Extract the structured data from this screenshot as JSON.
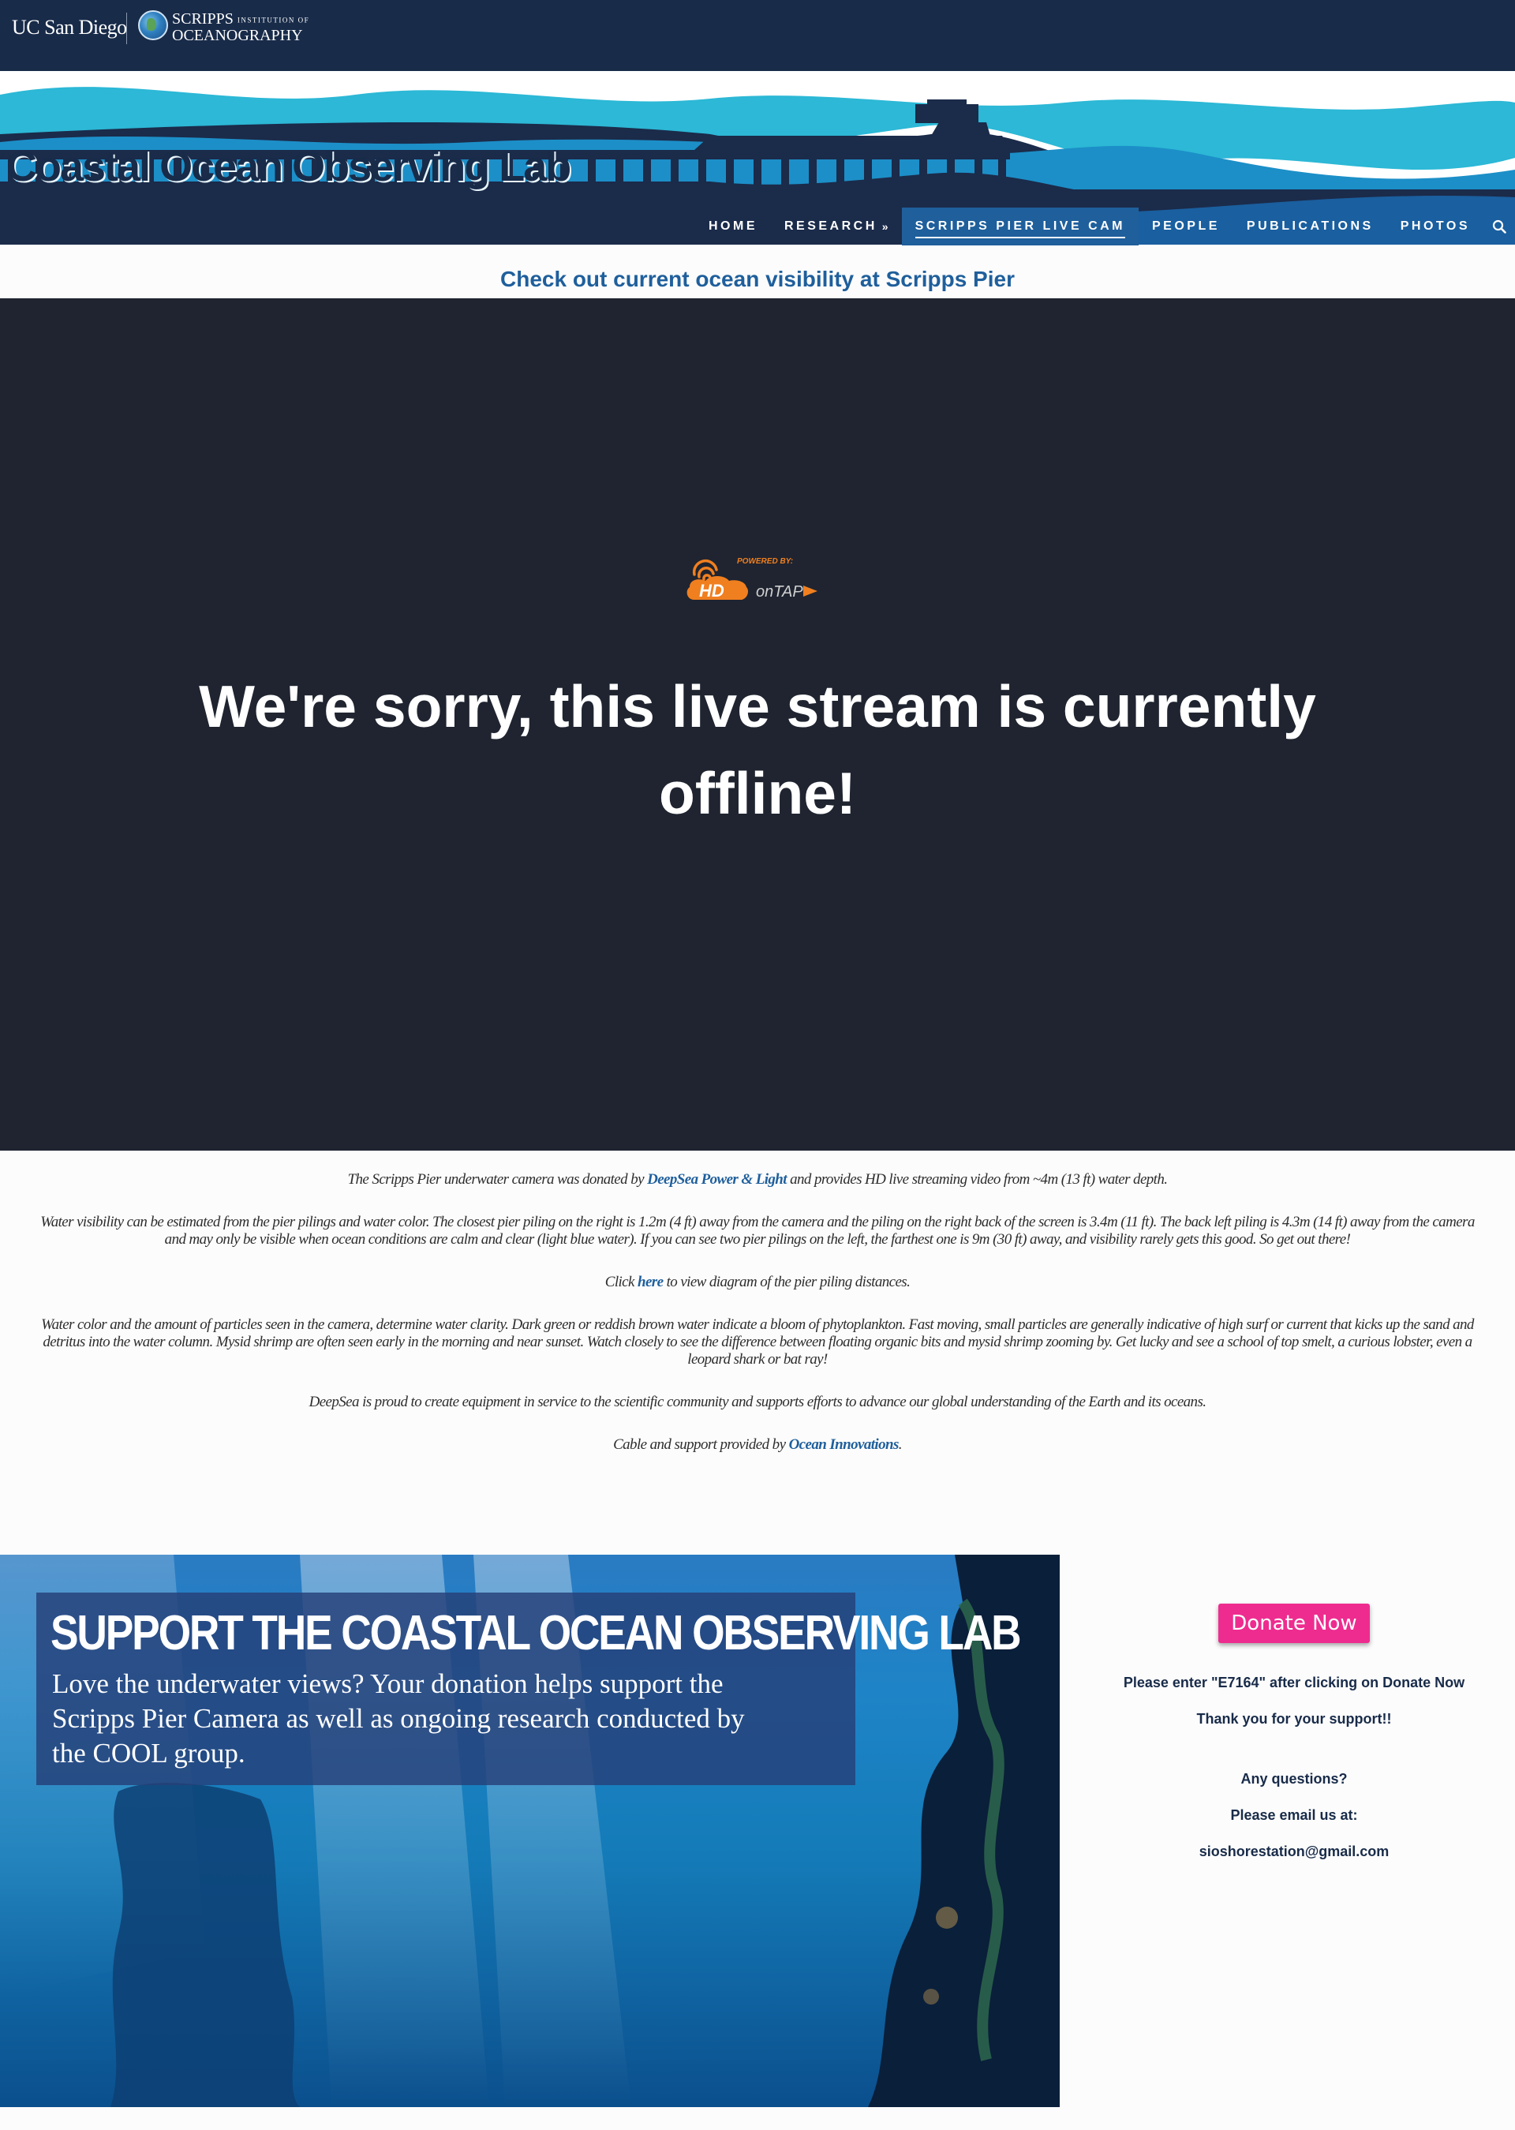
{
  "header": {
    "ucsd_logo": "UC San Diego",
    "scripps_logo_line1": "SCRIPPS",
    "scripps_logo_small": "INSTITUTION OF",
    "scripps_logo_line2": "OCEANOGRAPHY"
  },
  "banner": {
    "site_title": "Coastal Ocean Observing Lab"
  },
  "nav": {
    "items": [
      {
        "label": "HOME"
      },
      {
        "label": "RESEARCH"
      },
      {
        "label": "SCRIPPS PIER LIVE CAM"
      },
      {
        "label": "PEOPLE"
      },
      {
        "label": "PUBLICATIONS"
      },
      {
        "label": "PHOTOS"
      }
    ],
    "active": "SCRIPPS PIER LIVE CAM",
    "research_chevron_icon": "double-chevron-down-icon",
    "search_icon": "search-icon"
  },
  "headline": "Check out current ocean visibility at Scripps Pier",
  "video": {
    "logo_powered": "POWERED BY:",
    "logo_hd": "HD",
    "logo_ontap": "onTAP",
    "message": "We're sorry, this live stream is currently offline!"
  },
  "description": {
    "p1_pre": "The Scripps Pier underwater camera was donated by ",
    "p1_link": "DeepSea Power & Light",
    "p1_post": " and provides HD live streaming video from ~4m (13 ft) water depth.",
    "p2": "Water visibility can be estimated  from the pier pilings and water color. The closest  pier piling on the right is  1.2m (4 ft)  away from the camera and the piling on the right back of the screen is 3.4m (11 ft). The back left piling is 4.3m (14 ft) away from the camera and  may only be visible when ocean conditions are calm and clear (light blue water).  If you can  see two pier pilings on the left, the farthest one  is 9m (30 ft) away, and visibility rarely gets this good. So get out there!",
    "p3_pre": "Click ",
    "p3_link": "here",
    "p3_post": " to view diagram of the pier piling distances.",
    "p4": "Water color and the amount of particles seen in the camera, determine water clarity. Dark green or reddish  brown water indicate a bloom of phytoplankton. Fast moving, small particles are generally indicative of high surf or current that kicks up the sand  and detritus into the water column. Mysid shrimp are often seen early in the morning and near sunset. Watch closely to see the difference between floating organic bits and mysid shrimp zooming by. Get lucky and see a school of top smelt, a curious lobster, even a leopard shark or bat ray!",
    "p5": "DeepSea is proud to create equipment in service to the scientific community and supports efforts to advance our global understanding of the Earth and its oceans.",
    "p6_pre": "Cable and support provided by ",
    "p6_link": "Ocean Innovations",
    "p6_post": "."
  },
  "support": {
    "title": "SUPPORT THE COASTAL OCEAN OBSERVING LAB",
    "body": "Love the underwater views? Your donation helps support the Scripps Pier Camera as well as ongoing research conducted by the COOL group."
  },
  "donate": {
    "button": "Donate Now",
    "note": "Please enter \"E7164\"  after clicking on Donate Now",
    "thanks": "Thank you for your support!!",
    "questions": "Any questions?",
    "email_prompt": "Please email us at:",
    "email": "sioshorestation@gmail.com"
  },
  "colors": {
    "navy": "#182b49",
    "nav_active": "#1f5f9c",
    "link_blue": "#1f5f9c",
    "video_bg": "#1f2430",
    "donate_pink": "#ee2c8f",
    "wave_light": "#2cb8d6",
    "wave_mid": "#1c8fc8"
  }
}
